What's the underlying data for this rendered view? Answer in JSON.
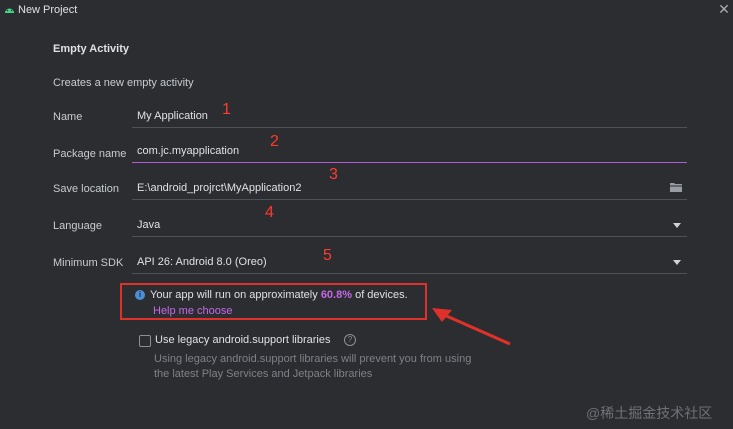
{
  "window": {
    "title": "New Project",
    "close_icon": "close-icon",
    "app_icon": "android-icon"
  },
  "form": {
    "section_title": "Empty Activity",
    "subtitle": "Creates a new empty activity",
    "fields": {
      "name": {
        "label": "Name",
        "value": "My Application"
      },
      "package": {
        "label": "Package name",
        "value": "com.jc.myapplication"
      },
      "save": {
        "label": "Save location",
        "value": "E:\\android_projrct\\MyApplication2",
        "icon": "folder-icon"
      },
      "language": {
        "label": "Language",
        "value": "Java"
      },
      "sdk": {
        "label": "Minimum SDK",
        "value": "API 26: Android 8.0 (Oreo)"
      }
    }
  },
  "info": {
    "text_before": "Your app will run on approximately ",
    "percent": "60.8%",
    "text_after": " of devices.",
    "link": "Help me choose",
    "icon": "info-icon"
  },
  "legacy": {
    "label": "Use legacy android.support libraries",
    "note_line1": "Using legacy android.support libraries will prevent you from using",
    "note_line2": "the latest Play Services and Jetpack libraries"
  },
  "annotations": [
    "1",
    "2",
    "3",
    "4",
    "5"
  ],
  "watermark": "@稀土掘金技术社区",
  "colors": {
    "accent": "#c569e8",
    "annotation": "#ff3b30",
    "background": "#2b2d30"
  }
}
